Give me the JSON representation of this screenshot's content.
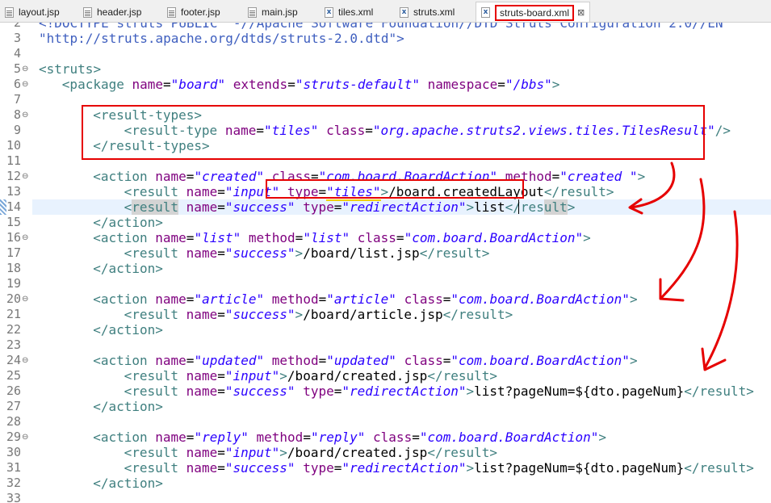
{
  "tabs": [
    {
      "label": "layout.jsp",
      "icon": "jsp-file-icon"
    },
    {
      "label": "header.jsp",
      "icon": "jsp-file-icon"
    },
    {
      "label": "footer.jsp",
      "icon": "jsp-file-icon"
    },
    {
      "label": "main.jsp",
      "icon": "jsp-file-icon"
    },
    {
      "label": "tiles.xml",
      "icon": "xml-file-icon"
    },
    {
      "label": "struts.xml",
      "icon": "xml-file-icon"
    },
    {
      "label": "struts-board.xml",
      "icon": "xml-file-icon",
      "active": true,
      "close": "⊠"
    }
  ],
  "lines": [
    {
      "n": "2",
      "code": "<!DOCTYPE struts PUBLIC \"-//Apache Software Foundation//DTD Struts Configuration 2.0//EN\""
    },
    {
      "n": "3",
      "code": "\"http://struts.apache.org/dtds/struts-2.0.dtd\">"
    },
    {
      "n": "4",
      "code": ""
    },
    {
      "n": "5",
      "code": "<struts>"
    },
    {
      "n": "6",
      "code": "<package name=\"board\" extends=\"struts-default\" namespace=\"/bbs\">"
    },
    {
      "n": "7",
      "code": ""
    },
    {
      "n": "8",
      "code": "<result-types>"
    },
    {
      "n": "9",
      "code": "<result-type name=\"tiles\" class=\"org.apache.struts2.views.tiles.TilesResult\"/>"
    },
    {
      "n": "10",
      "code": "</result-types>"
    },
    {
      "n": "11",
      "code": ""
    },
    {
      "n": "12",
      "code": "<action name=\"created\" class=\"com.board.BoardAction\" method=\"created \">"
    },
    {
      "n": "13",
      "code": "<result name=\"input\" type=\"tiles\">/board.createdLayout</result>"
    },
    {
      "n": "14",
      "code": "<result name=\"success\" type=\"redirectAction\">list</result>"
    },
    {
      "n": "15",
      "code": "</action>"
    },
    {
      "n": "16",
      "code": "<action name=\"list\" method=\"list\" class=\"com.board.BoardAction\">"
    },
    {
      "n": "17",
      "code": "<result name=\"success\">/board/list.jsp</result>"
    },
    {
      "n": "18",
      "code": "</action>"
    },
    {
      "n": "19",
      "code": ""
    },
    {
      "n": "20",
      "code": "<action name=\"article\" method=\"article\" class=\"com.board.BoardAction\">"
    },
    {
      "n": "21",
      "code": "<result name=\"success\">/board/article.jsp</result>"
    },
    {
      "n": "22",
      "code": "</action>"
    },
    {
      "n": "23",
      "code": ""
    },
    {
      "n": "24",
      "code": "<action name=\"updated\" method=\"updated\" class=\"com.board.BoardAction\">"
    },
    {
      "n": "25",
      "code": "<result name=\"input\">/board/created.jsp</result>"
    },
    {
      "n": "26",
      "code": "<result name=\"success\" type=\"redirectAction\">list?pageNum=${dto.pageNum}</result>"
    },
    {
      "n": "27",
      "code": "</action>"
    },
    {
      "n": "28",
      "code": ""
    },
    {
      "n": "29",
      "code": "<action name=\"reply\" method=\"reply\" class=\"com.board.BoardAction\">"
    },
    {
      "n": "30",
      "code": "<result name=\"input\">/board/created.jsp</result>"
    },
    {
      "n": "31",
      "code": "<result name=\"success\" type=\"redirectAction\">list?pageNum=${dto.pageNum}</result>"
    },
    {
      "n": "32",
      "code": "</action>"
    },
    {
      "n": "33",
      "code": ""
    }
  ],
  "colors": {
    "tag": "#3f7f7f",
    "attribute": "#7f007f",
    "value": "#2a00ff",
    "annotation": "#e60000",
    "current_line": "#e8f2fe"
  }
}
